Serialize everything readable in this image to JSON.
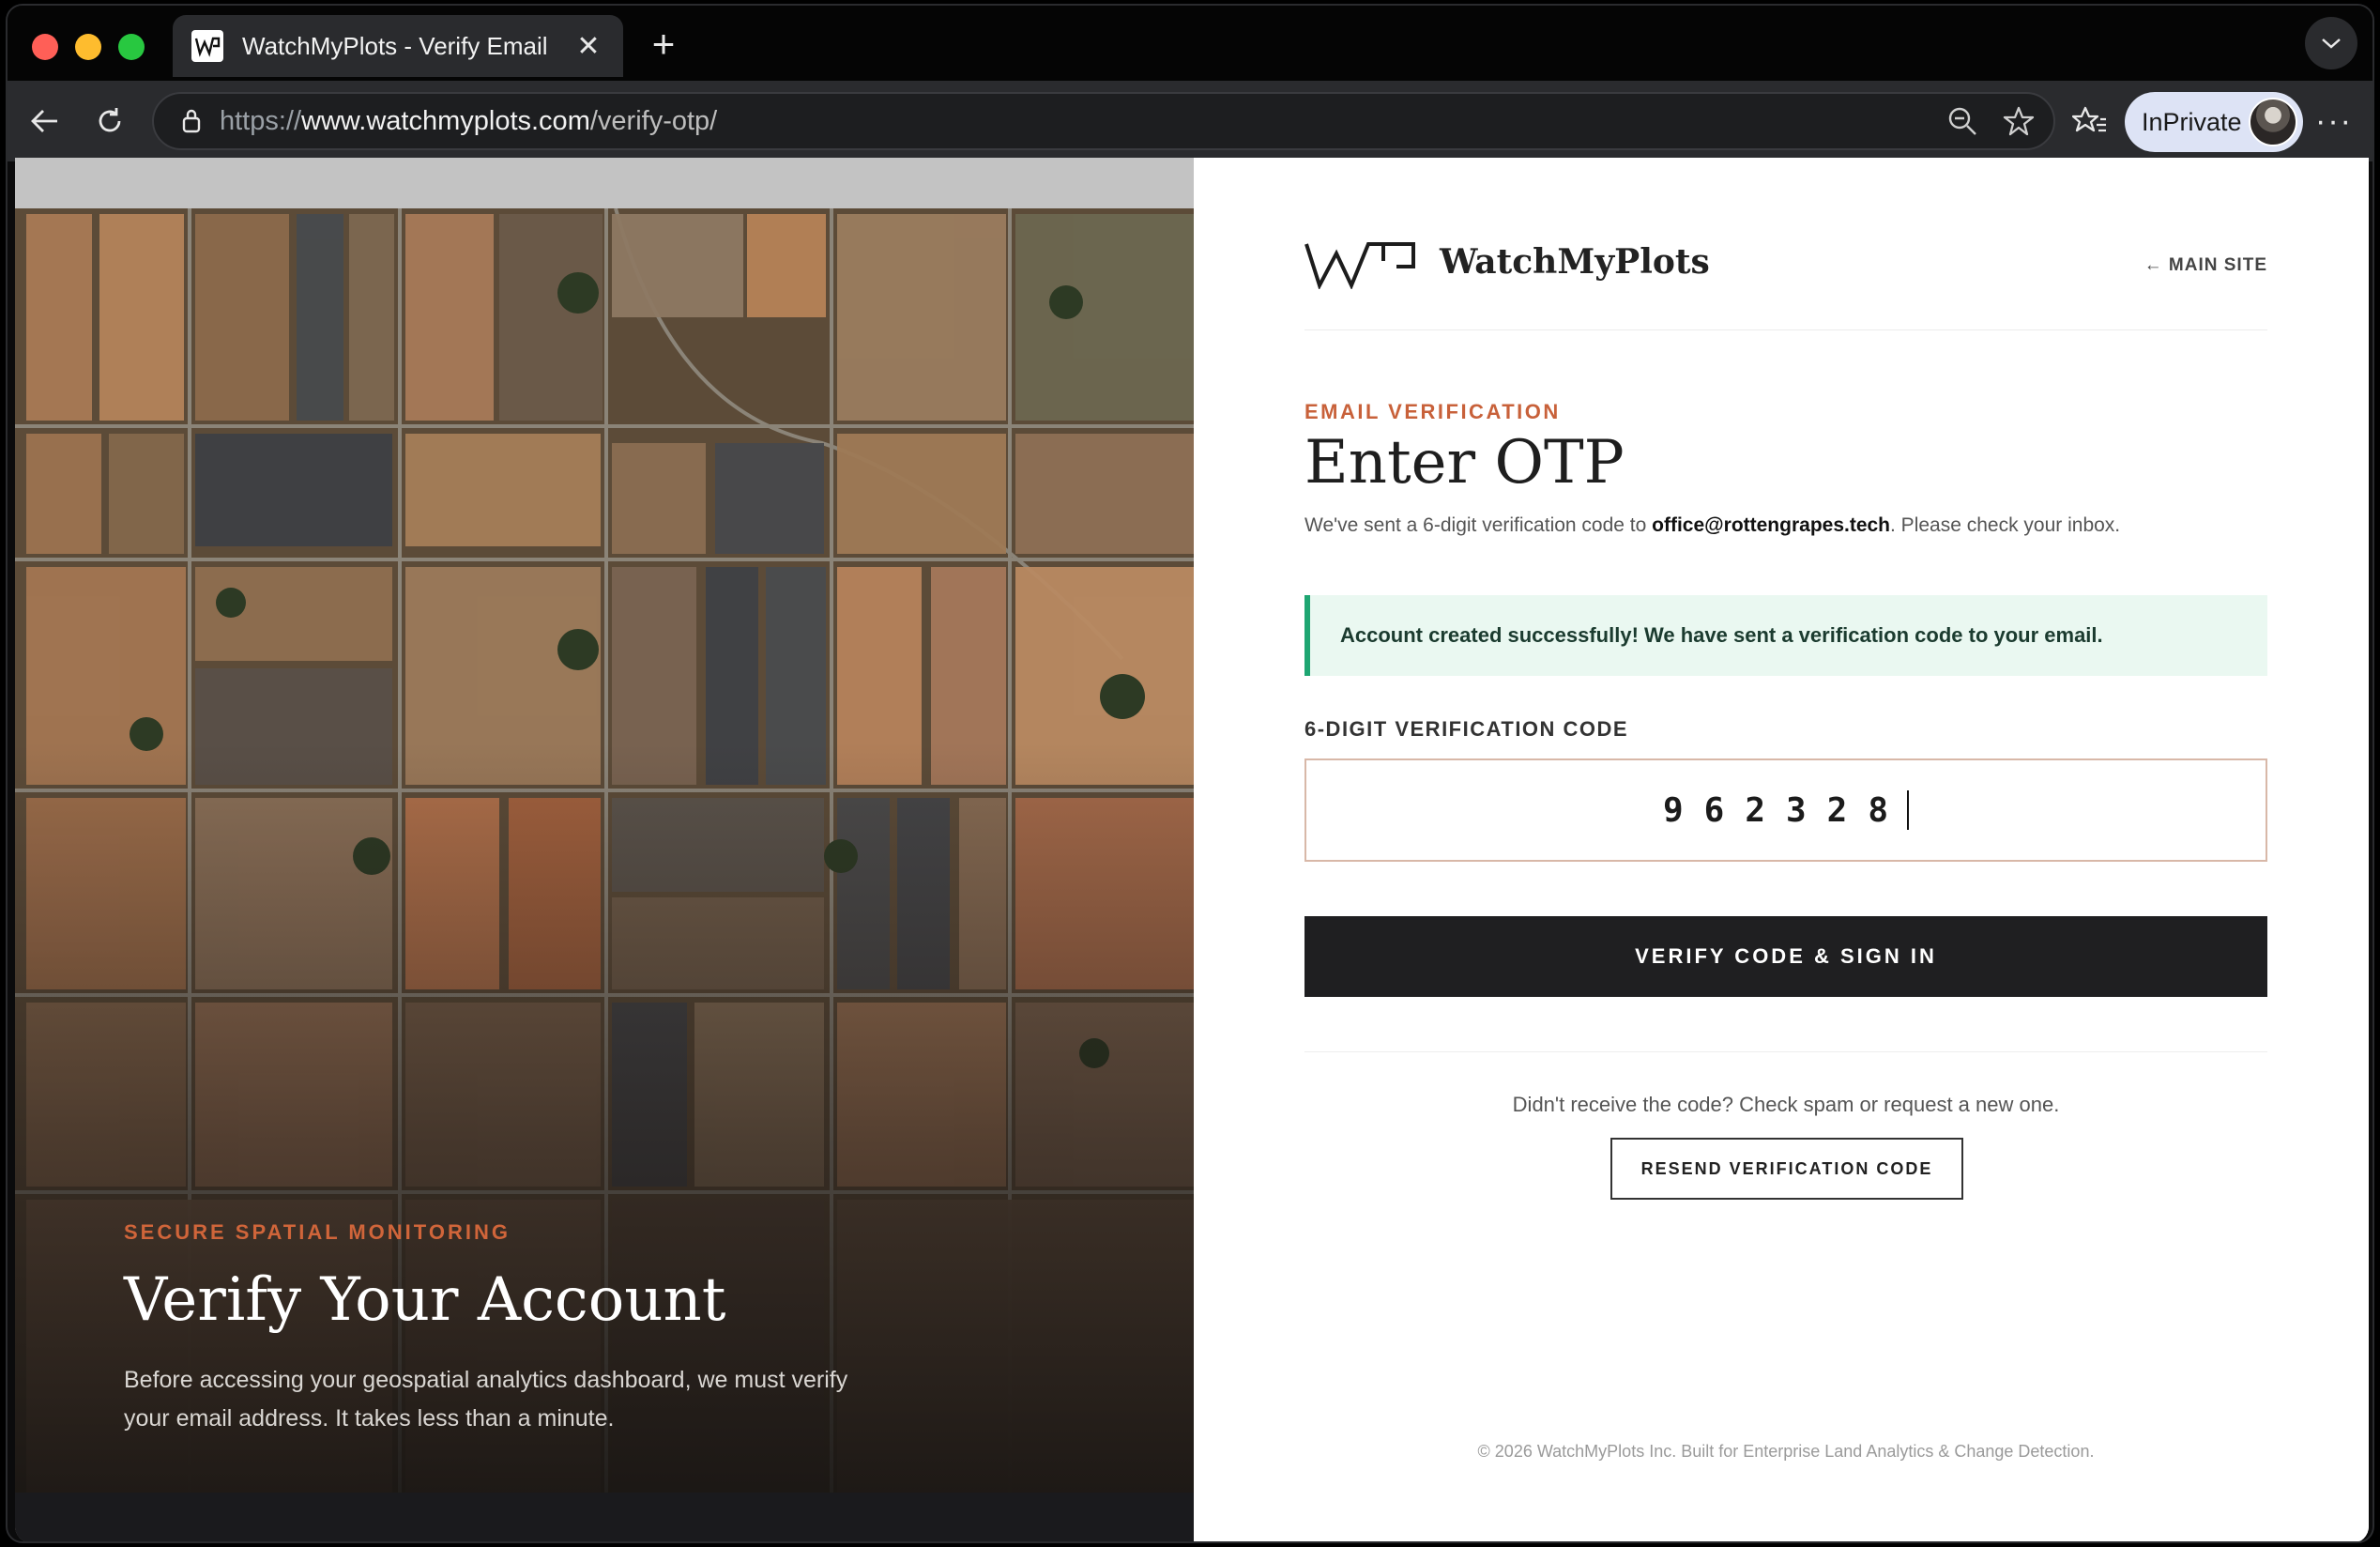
{
  "browser": {
    "tab_title": "WatchMyPlots - Verify Email",
    "url_scheme": "https://",
    "url_host": "www.watchmyplots.com",
    "url_path": "/verify-otp/",
    "inprivate_label": "InPrivate"
  },
  "hero": {
    "kicker": "SECURE SPATIAL MONITORING",
    "title": "Verify Your Account",
    "description": "Before accessing your geospatial analytics dashboard, we must verify your email address. It takes less than a minute."
  },
  "header": {
    "brand": "WatchMyPlots",
    "main_site_link": "← MAIN SITE"
  },
  "form": {
    "kicker": "EMAIL VERIFICATION",
    "title": "Enter OTP",
    "subtext_before": "We've sent a 6-digit verification code to ",
    "email": "office@rottengrapes.tech",
    "subtext_after": ". Please check your inbox.",
    "alert": "Account created successfully! We have sent a verification code to your email.",
    "code_label": "6-DIGIT VERIFICATION CODE",
    "code_value": "962328",
    "verify_button": "VERIFY CODE & SIGN IN",
    "help_text": "Didn't receive the code? Check spam or request a new one.",
    "resend_button": "RESEND VERIFICATION CODE"
  },
  "footer": {
    "text": "© 2026 WatchMyPlots Inc. Built for Enterprise Land Analytics & Change Detection."
  },
  "colors": {
    "accent": "#c8613a",
    "success": "#1ea672",
    "dark": "#1f1f21"
  }
}
